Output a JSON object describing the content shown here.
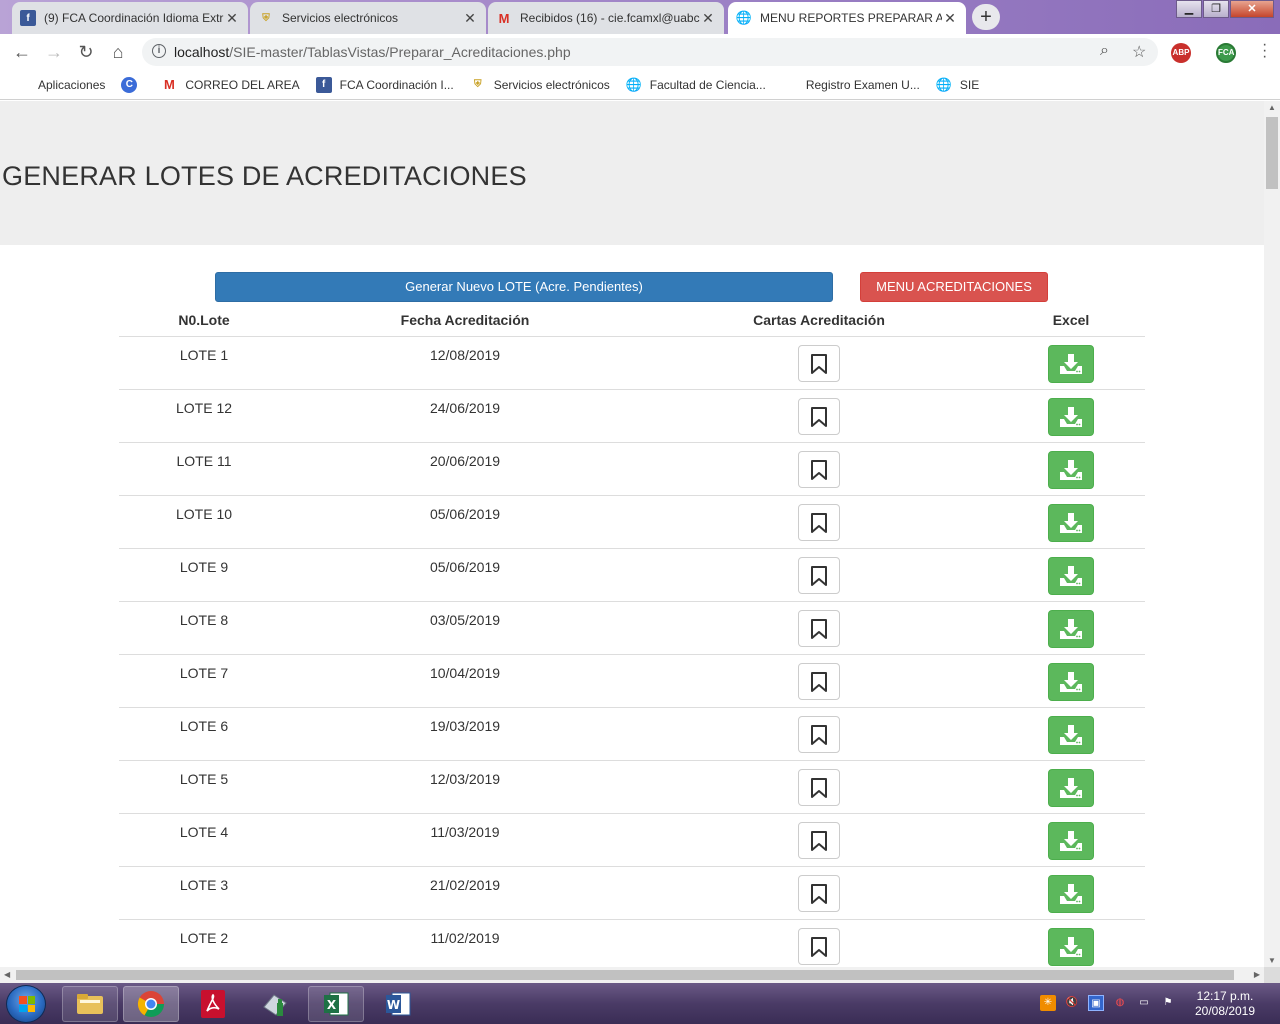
{
  "browser": {
    "tabs": [
      {
        "title": "(9) FCA Coordinación Idioma Extr",
        "icon": "facebook-icon",
        "active": false
      },
      {
        "title": "Servicios electrónicos",
        "icon": "shield-crest-icon",
        "active": false
      },
      {
        "title": "Recibidos (16) - cie.fcamxl@uabc",
        "icon": "gmail-icon",
        "active": false
      },
      {
        "title": "MENU REPORTES PREPARAR ACR",
        "icon": "globe-icon",
        "active": true
      }
    ],
    "new_tab_symbol": "+",
    "url_host": "localhost",
    "url_path": "/SIE-master/TablasVistas/Preparar_Acreditaciones.php",
    "extensions": [
      "ABP",
      "FCA"
    ],
    "bookmarks": [
      {
        "label": "Aplicaciones",
        "icon": "apps-grid-icon"
      },
      {
        "label": "",
        "icon": "c-circle-icon"
      },
      {
        "label": "CORREO DEL AREA",
        "icon": "gmail-icon"
      },
      {
        "label": "FCA Coordinación I...",
        "icon": "facebook-icon"
      },
      {
        "label": "Servicios electrónicos",
        "icon": "shield-crest-icon"
      },
      {
        "label": "Facultad de Ciencia...",
        "icon": "globe-icon"
      },
      {
        "label": "Registro Examen U...",
        "icon": "blank-page-icon"
      },
      {
        "label": "SIE",
        "icon": "globe-icon"
      }
    ]
  },
  "page": {
    "title": "GENERAR LOTES DE ACREDITACIONES",
    "btn_new_label": "Generar Nuevo LOTE (Acre. Pendientes)",
    "btn_menu_label": "MENU ACREDITACIONES",
    "table": {
      "headers": [
        "N0.Lote",
        "Fecha Acreditación",
        "Cartas Acreditación",
        "Excel"
      ],
      "rows": [
        {
          "lote": "LOTE 1",
          "fecha": "12/08/2019"
        },
        {
          "lote": "LOTE 12",
          "fecha": "24/06/2019"
        },
        {
          "lote": "LOTE 11",
          "fecha": "20/06/2019"
        },
        {
          "lote": "LOTE 10",
          "fecha": "05/06/2019"
        },
        {
          "lote": "LOTE 9",
          "fecha": "05/06/2019"
        },
        {
          "lote": "LOTE 8",
          "fecha": "03/05/2019"
        },
        {
          "lote": "LOTE 7",
          "fecha": "10/04/2019"
        },
        {
          "lote": "LOTE 6",
          "fecha": "19/03/2019"
        },
        {
          "lote": "LOTE 5",
          "fecha": "12/03/2019"
        },
        {
          "lote": "LOTE 4",
          "fecha": "11/03/2019"
        },
        {
          "lote": "LOTE 3",
          "fecha": "21/02/2019"
        },
        {
          "lote": "LOTE 2",
          "fecha": "11/02/2019"
        }
      ]
    }
  },
  "taskbar": {
    "apps": [
      "file-explorer-icon",
      "chrome-icon",
      "acrobat-icon",
      "setup-tool-icon",
      "excel-icon",
      "word-icon"
    ],
    "clock_time": "12:17 p.m.",
    "clock_date": "20/08/2019"
  },
  "colors": {
    "primary": "#337ab7",
    "danger": "#d9534f",
    "success": "#5cb85c",
    "jumbotron": "#eeeeee"
  }
}
